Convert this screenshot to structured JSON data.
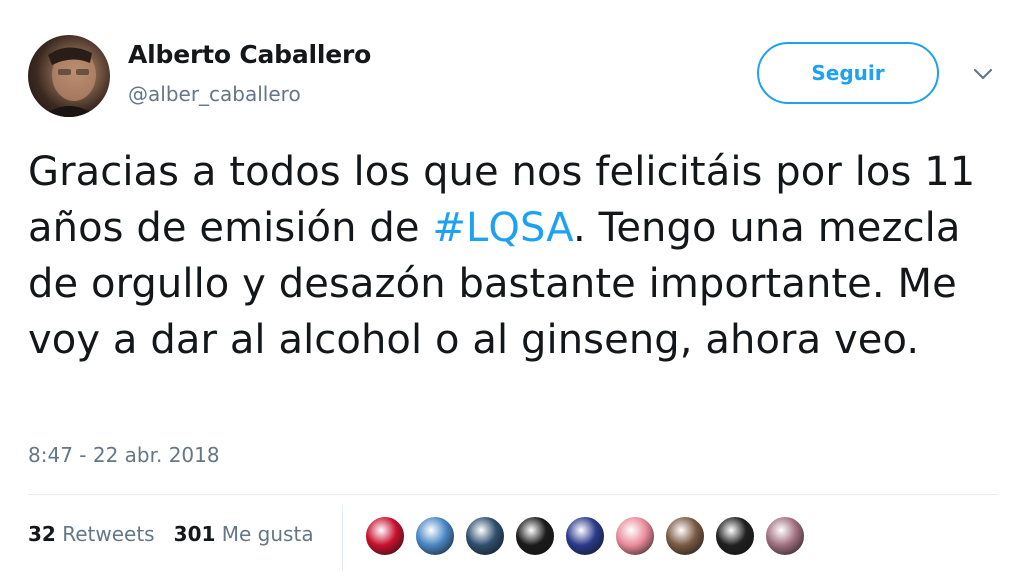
{
  "author": {
    "name": "Alberto Caballero",
    "handle": "@alber_caballero",
    "avatar_icon": "user-avatar"
  },
  "follow_button": {
    "label": "Seguir",
    "color": "#1da1f2"
  },
  "menu": {
    "icon": "chevron-down-icon"
  },
  "tweet": {
    "text_before": "Gracias a todos los que nos felicitáis por los 11 años de emisión de ",
    "hashtag": "#LQSA",
    "text_after": ". Tengo una mezcla de orgullo y desazón bastante importante. Me voy a dar al alcohol o al ginseng, ahora veo.",
    "hashtag_color": "#1da1f2"
  },
  "timestamp": "8:47 - 22 abr. 2018",
  "stats": {
    "retweets_count": "32",
    "retweets_label": "Retweets",
    "likes_count": "301",
    "likes_label": "Me gusta"
  },
  "likers": [
    {
      "icon": "spain-flag-avatar",
      "color": "#c8102e"
    },
    {
      "icon": "landscape-avatar",
      "color": "#4a86c5"
    },
    {
      "icon": "group-photo-avatar",
      "color": "#2f4f6f"
    },
    {
      "icon": "tv-logo-avatar",
      "color": "#1b1b1b"
    },
    {
      "icon": "person-photo-avatar",
      "color": "#2b3a8c"
    },
    {
      "icon": "cartoon-avatar",
      "color": "#e98a9a"
    },
    {
      "icon": "couple-photo-avatar",
      "color": "#7a5a44"
    },
    {
      "icon": "dark-photo-avatar",
      "color": "#202020"
    },
    {
      "icon": "friends-photo-avatar",
      "color": "#a07080"
    }
  ]
}
